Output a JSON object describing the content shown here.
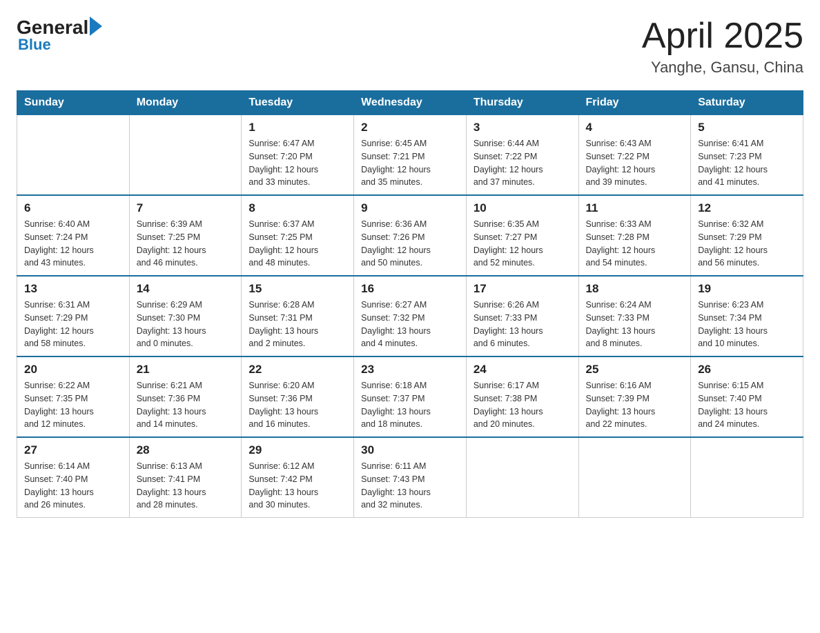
{
  "header": {
    "logo": {
      "general": "General",
      "blue": "Blue",
      "sub": "Blue"
    },
    "title": "April 2025",
    "subtitle": "Yanghe, Gansu, China"
  },
  "weekdays": [
    "Sunday",
    "Monday",
    "Tuesday",
    "Wednesday",
    "Thursday",
    "Friday",
    "Saturday"
  ],
  "weeks": [
    [
      {
        "day": "",
        "info": ""
      },
      {
        "day": "",
        "info": ""
      },
      {
        "day": "1",
        "info": "Sunrise: 6:47 AM\nSunset: 7:20 PM\nDaylight: 12 hours\nand 33 minutes."
      },
      {
        "day": "2",
        "info": "Sunrise: 6:45 AM\nSunset: 7:21 PM\nDaylight: 12 hours\nand 35 minutes."
      },
      {
        "day": "3",
        "info": "Sunrise: 6:44 AM\nSunset: 7:22 PM\nDaylight: 12 hours\nand 37 minutes."
      },
      {
        "day": "4",
        "info": "Sunrise: 6:43 AM\nSunset: 7:22 PM\nDaylight: 12 hours\nand 39 minutes."
      },
      {
        "day": "5",
        "info": "Sunrise: 6:41 AM\nSunset: 7:23 PM\nDaylight: 12 hours\nand 41 minutes."
      }
    ],
    [
      {
        "day": "6",
        "info": "Sunrise: 6:40 AM\nSunset: 7:24 PM\nDaylight: 12 hours\nand 43 minutes."
      },
      {
        "day": "7",
        "info": "Sunrise: 6:39 AM\nSunset: 7:25 PM\nDaylight: 12 hours\nand 46 minutes."
      },
      {
        "day": "8",
        "info": "Sunrise: 6:37 AM\nSunset: 7:25 PM\nDaylight: 12 hours\nand 48 minutes."
      },
      {
        "day": "9",
        "info": "Sunrise: 6:36 AM\nSunset: 7:26 PM\nDaylight: 12 hours\nand 50 minutes."
      },
      {
        "day": "10",
        "info": "Sunrise: 6:35 AM\nSunset: 7:27 PM\nDaylight: 12 hours\nand 52 minutes."
      },
      {
        "day": "11",
        "info": "Sunrise: 6:33 AM\nSunset: 7:28 PM\nDaylight: 12 hours\nand 54 minutes."
      },
      {
        "day": "12",
        "info": "Sunrise: 6:32 AM\nSunset: 7:29 PM\nDaylight: 12 hours\nand 56 minutes."
      }
    ],
    [
      {
        "day": "13",
        "info": "Sunrise: 6:31 AM\nSunset: 7:29 PM\nDaylight: 12 hours\nand 58 minutes."
      },
      {
        "day": "14",
        "info": "Sunrise: 6:29 AM\nSunset: 7:30 PM\nDaylight: 13 hours\nand 0 minutes."
      },
      {
        "day": "15",
        "info": "Sunrise: 6:28 AM\nSunset: 7:31 PM\nDaylight: 13 hours\nand 2 minutes."
      },
      {
        "day": "16",
        "info": "Sunrise: 6:27 AM\nSunset: 7:32 PM\nDaylight: 13 hours\nand 4 minutes."
      },
      {
        "day": "17",
        "info": "Sunrise: 6:26 AM\nSunset: 7:33 PM\nDaylight: 13 hours\nand 6 minutes."
      },
      {
        "day": "18",
        "info": "Sunrise: 6:24 AM\nSunset: 7:33 PM\nDaylight: 13 hours\nand 8 minutes."
      },
      {
        "day": "19",
        "info": "Sunrise: 6:23 AM\nSunset: 7:34 PM\nDaylight: 13 hours\nand 10 minutes."
      }
    ],
    [
      {
        "day": "20",
        "info": "Sunrise: 6:22 AM\nSunset: 7:35 PM\nDaylight: 13 hours\nand 12 minutes."
      },
      {
        "day": "21",
        "info": "Sunrise: 6:21 AM\nSunset: 7:36 PM\nDaylight: 13 hours\nand 14 minutes."
      },
      {
        "day": "22",
        "info": "Sunrise: 6:20 AM\nSunset: 7:36 PM\nDaylight: 13 hours\nand 16 minutes."
      },
      {
        "day": "23",
        "info": "Sunrise: 6:18 AM\nSunset: 7:37 PM\nDaylight: 13 hours\nand 18 minutes."
      },
      {
        "day": "24",
        "info": "Sunrise: 6:17 AM\nSunset: 7:38 PM\nDaylight: 13 hours\nand 20 minutes."
      },
      {
        "day": "25",
        "info": "Sunrise: 6:16 AM\nSunset: 7:39 PM\nDaylight: 13 hours\nand 22 minutes."
      },
      {
        "day": "26",
        "info": "Sunrise: 6:15 AM\nSunset: 7:40 PM\nDaylight: 13 hours\nand 24 minutes."
      }
    ],
    [
      {
        "day": "27",
        "info": "Sunrise: 6:14 AM\nSunset: 7:40 PM\nDaylight: 13 hours\nand 26 minutes."
      },
      {
        "day": "28",
        "info": "Sunrise: 6:13 AM\nSunset: 7:41 PM\nDaylight: 13 hours\nand 28 minutes."
      },
      {
        "day": "29",
        "info": "Sunrise: 6:12 AM\nSunset: 7:42 PM\nDaylight: 13 hours\nand 30 minutes."
      },
      {
        "day": "30",
        "info": "Sunrise: 6:11 AM\nSunset: 7:43 PM\nDaylight: 13 hours\nand 32 minutes."
      },
      {
        "day": "",
        "info": ""
      },
      {
        "day": "",
        "info": ""
      },
      {
        "day": "",
        "info": ""
      }
    ]
  ]
}
